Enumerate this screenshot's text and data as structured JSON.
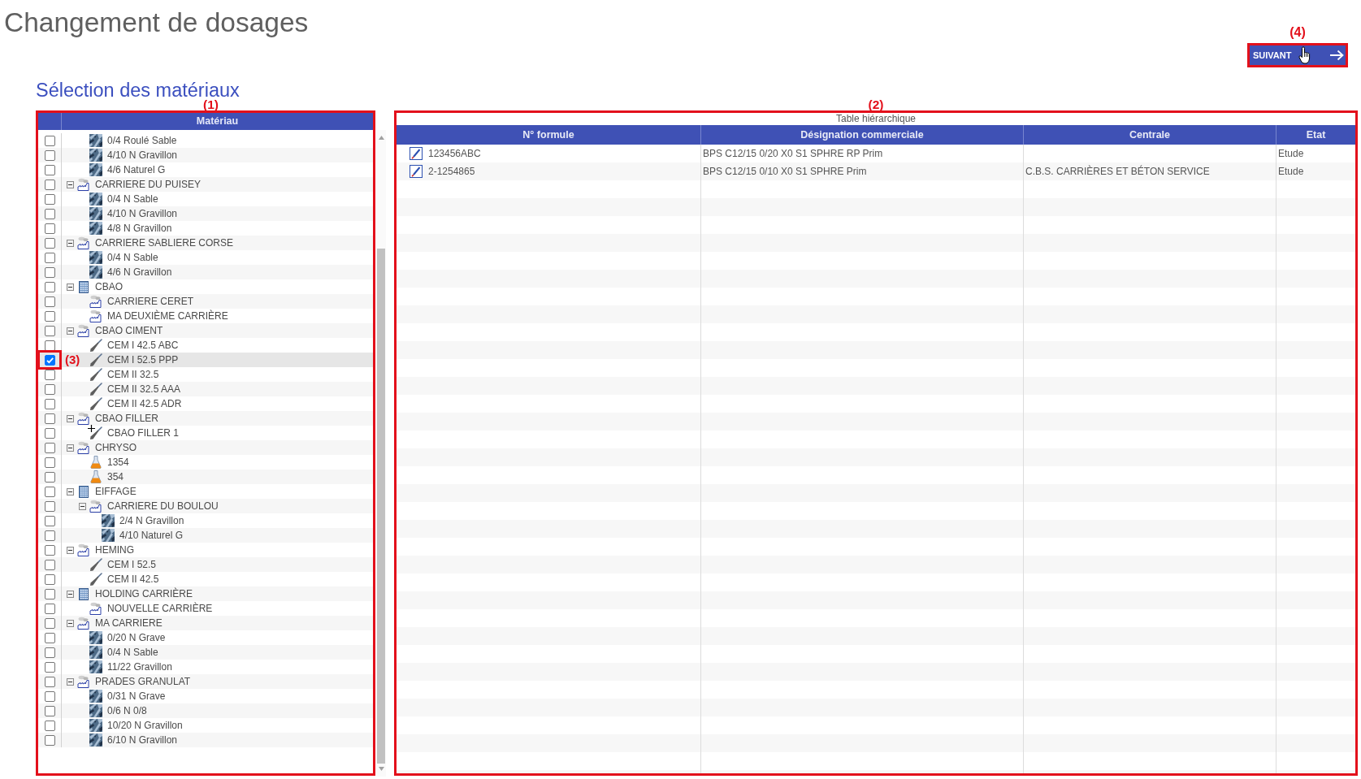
{
  "page_title": "Changement de dosages",
  "next_button": {
    "label": "SUIVANT",
    "callout": "(4)",
    "hand_cursor": true
  },
  "section_title": "Sélection des matériaux",
  "material_tree": {
    "callout": "(1)",
    "column": "Matériau",
    "items": [
      {
        "children": [
          {
            "kind": "aggregate",
            "label": "0/4 Roulé Sable",
            "checked": false
          },
          {
            "kind": "aggregate",
            "label": "4/10 N Gravillon",
            "checked": false
          },
          {
            "kind": "aggregate",
            "label": "4/6 Naturel G",
            "checked": false
          }
        ]
      },
      {
        "kind": "quarry",
        "label": "CARRIERE DU PUISEY",
        "checked": false,
        "expanded": true,
        "children": [
          {
            "kind": "aggregate",
            "label": "0/4 N Sable",
            "checked": false
          },
          {
            "kind": "aggregate",
            "label": "4/10 N Gravillon",
            "checked": false
          },
          {
            "kind": "aggregate",
            "label": "4/8 N Gravillon",
            "checked": false
          }
        ]
      },
      {
        "kind": "quarry",
        "label": "CARRIERE SABLIERE CORSE",
        "checked": false,
        "expanded": true,
        "children": [
          {
            "kind": "aggregate",
            "label": "0/4 N Sable",
            "checked": false
          },
          {
            "kind": "aggregate",
            "label": "4/6 N Gravillon",
            "checked": false
          }
        ]
      },
      {
        "kind": "company",
        "label": "CBAO",
        "checked": false,
        "expanded": true,
        "children": [
          {
            "kind": "quarry",
            "label": "CARRIERE CERET",
            "checked": false
          },
          {
            "kind": "quarry",
            "label": "MA DEUXIÈME CARRIÈRE",
            "checked": false
          }
        ]
      },
      {
        "kind": "quarry",
        "label": "CBAO CIMENT",
        "checked": false,
        "expanded": true,
        "children": [
          {
            "kind": "cement",
            "label": "CEM I 42.5 ABC",
            "checked": false
          },
          {
            "kind": "cement",
            "label": "CEM I 52.5 PPP",
            "checked": true,
            "callout": "(3)"
          },
          {
            "kind": "cement",
            "label": "CEM II 32.5",
            "checked": false
          },
          {
            "kind": "cement",
            "label": "CEM II 32.5 AAA",
            "checked": false
          },
          {
            "kind": "cement",
            "label": "CEM II 42.5 ADR",
            "checked": false
          }
        ]
      },
      {
        "kind": "quarry",
        "label": "CBAO FILLER",
        "checked": false,
        "expanded": true,
        "children": [
          {
            "kind": "cement",
            "label": "CBAO FILLER 1",
            "checked": false,
            "crosshair_cursor": true
          }
        ]
      },
      {
        "kind": "quarry",
        "label": "CHRYSO",
        "checked": false,
        "expanded": true,
        "children": [
          {
            "kind": "admixture",
            "label": "1354",
            "checked": false
          },
          {
            "kind": "admixture",
            "label": "354",
            "checked": false
          }
        ]
      },
      {
        "kind": "company",
        "label": "EIFFAGE",
        "checked": false,
        "expanded": true,
        "children": [
          {
            "kind": "quarry",
            "label": "CARRIERE DU BOULOU",
            "checked": false,
            "expanded": true,
            "children": [
              {
                "kind": "aggregate",
                "label": "2/4 N Gravillon",
                "checked": false
              },
              {
                "kind": "aggregate",
                "label": "4/10 Naturel G",
                "checked": false
              }
            ]
          }
        ]
      },
      {
        "kind": "quarry",
        "label": "HEMING",
        "checked": false,
        "expanded": true,
        "children": [
          {
            "kind": "cement",
            "label": "CEM I 52.5",
            "checked": false
          },
          {
            "kind": "cement",
            "label": "CEM II 42.5",
            "checked": false
          }
        ]
      },
      {
        "kind": "company",
        "label": "HOLDING CARRIÈRE",
        "checked": false,
        "expanded": true,
        "children": [
          {
            "kind": "quarry",
            "label": "NOUVELLE CARRIÈRE",
            "checked": false
          }
        ]
      },
      {
        "kind": "quarry",
        "label": "MA CARRIERE",
        "checked": false,
        "expanded": true,
        "children": [
          {
            "kind": "aggregate",
            "label": "0/20 N Grave",
            "checked": false
          },
          {
            "kind": "aggregate",
            "label": "0/4 N Sable",
            "checked": false
          },
          {
            "kind": "aggregate",
            "label": "11/22 Gravillon",
            "checked": false
          }
        ]
      },
      {
        "kind": "quarry",
        "label": "PRADES GRANULAT",
        "checked": false,
        "expanded": true,
        "children": [
          {
            "kind": "aggregate",
            "label": "0/31 N Grave",
            "checked": false
          },
          {
            "kind": "aggregate",
            "label": "0/6 N 0/8",
            "checked": false
          },
          {
            "kind": "aggregate",
            "label": "10/20 N Gravillon",
            "checked": false
          },
          {
            "kind": "aggregate",
            "label": "6/10 N Gravillon",
            "checked": false
          }
        ]
      }
    ]
  },
  "formula_table": {
    "callout": "(2)",
    "caption": "Table hiérarchique",
    "columns": [
      "N° formule",
      "Désignation commerciale",
      "Centrale",
      "Etat"
    ],
    "rows": [
      {
        "formula": "123456ABC",
        "designation": "BPS C12/15 0/20 X0 S1 SPHRE RP Prim",
        "etat": "Etude"
      },
      {
        "formula": "2-1254865",
        "designation": "BPS C12/15 0/10 X0 S1 SPHRE Prim",
        "centrale": "C.B.S. CARRIÈRES ET BÉTON SERVICE",
        "etat": "Etude"
      }
    ]
  }
}
